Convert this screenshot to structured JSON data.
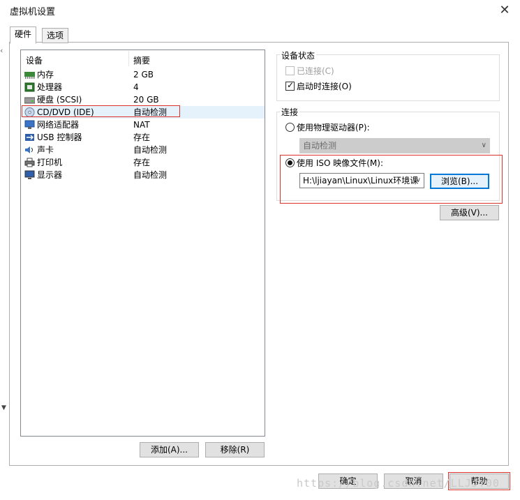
{
  "window": {
    "title": "虚拟机设置",
    "close_glyph": "✕"
  },
  "tabs": [
    {
      "label": "硬件"
    },
    {
      "label": "选项"
    }
  ],
  "device_list": {
    "headers": {
      "device": "设备",
      "summary": "摘要"
    },
    "rows": [
      {
        "name": "内存",
        "summary": "2 GB",
        "icon": "memory-icon"
      },
      {
        "name": "处理器",
        "summary": "4",
        "icon": "processor-icon"
      },
      {
        "name": "硬盘 (SCSI)",
        "summary": "20 GB",
        "icon": "hard-disk-icon"
      },
      {
        "name": "CD/DVD (IDE)",
        "summary": "自动检测",
        "icon": "cd-dvd-icon"
      },
      {
        "name": "网络适配器",
        "summary": "NAT",
        "icon": "network-adapter-icon"
      },
      {
        "name": "USB 控制器",
        "summary": "存在",
        "icon": "usb-icon"
      },
      {
        "name": "声卡",
        "summary": "自动检测",
        "icon": "sound-card-icon"
      },
      {
        "name": "打印机",
        "summary": "存在",
        "icon": "printer-icon"
      },
      {
        "name": "显示器",
        "summary": "自动检测",
        "icon": "display-icon"
      }
    ],
    "selected_index": 3
  },
  "list_buttons": {
    "add": "添加(A)...",
    "remove": "移除(R)"
  },
  "device_status": {
    "title": "设备状态",
    "connected": {
      "label": "已连接(C)",
      "checked": false,
      "disabled": true
    },
    "connect_at_power_on": {
      "label": "启动时连接(O)",
      "checked": true
    }
  },
  "connection": {
    "title": "连接",
    "physical_drive": {
      "label": "使用物理驱动器(P):",
      "selected": false,
      "combo_value": "自动检测"
    },
    "iso_image": {
      "label": "使用 ISO 映像文件(M):",
      "selected": true,
      "path_value": "H:\\ljiayan\\Linux\\Linux环境课",
      "browse_label": "浏览(B)..."
    },
    "advanced_label": "高级(V)..."
  },
  "footer_buttons": {
    "ok": "确定",
    "cancel": "取消",
    "help": "帮助"
  },
  "watermark": "https://blog.csdn.net/LLJJY00",
  "colors": {
    "highlight_box": "#e0302a",
    "focus_border": "#0078d7",
    "selection": "#e5f1fb"
  }
}
